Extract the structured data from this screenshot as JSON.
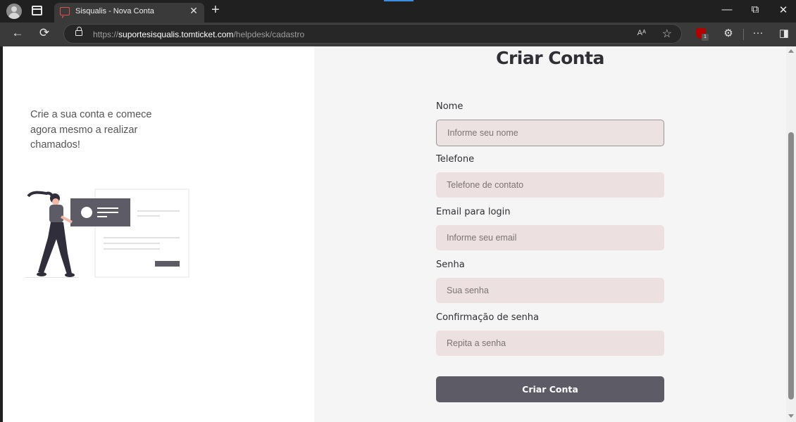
{
  "browser": {
    "tab_title": "Sisqualis - Nova Conta",
    "tab_close": "✕",
    "new_tab": "+",
    "url_scheme": "https://",
    "url_host": "suportesisqualis.tomticket.com",
    "url_path": "/helpdesk/cadastro",
    "read_aloud": "Aᴬ",
    "extension_badge": "1",
    "window_controls": {
      "minimize": "—",
      "restore": "⧉",
      "close": "✕"
    },
    "icons": [
      "profile-avatar",
      "tab-actions",
      "site-favicon",
      "back-arrow",
      "refresh",
      "lock",
      "read-aloud",
      "favorite-star",
      "ublock-extension",
      "extensions-puzzle",
      "more-menu",
      "sidebar-toggle"
    ]
  },
  "page": {
    "intro_text": "Crie a sua conta e comece agora mesmo a realizar chamados!",
    "heading": "Criar Conta",
    "form": {
      "fields": [
        {
          "label": "Nome",
          "placeholder": "Informe seu nome",
          "focused": true
        },
        {
          "label": "Telefone",
          "placeholder": "Telefone de contato"
        },
        {
          "label": "Email para login",
          "placeholder": "Informe seu email"
        },
        {
          "label": "Senha",
          "placeholder": "Sua senha"
        },
        {
          "label": "Confirmação de senha",
          "placeholder": "Repita a senha"
        }
      ],
      "submit_label": "Criar Conta"
    },
    "colors": {
      "field_bg": "#ede0e0",
      "button_bg": "#5d5b66",
      "heading": "#2f2f35",
      "right_pane_bg": "#f5f5f5"
    }
  }
}
